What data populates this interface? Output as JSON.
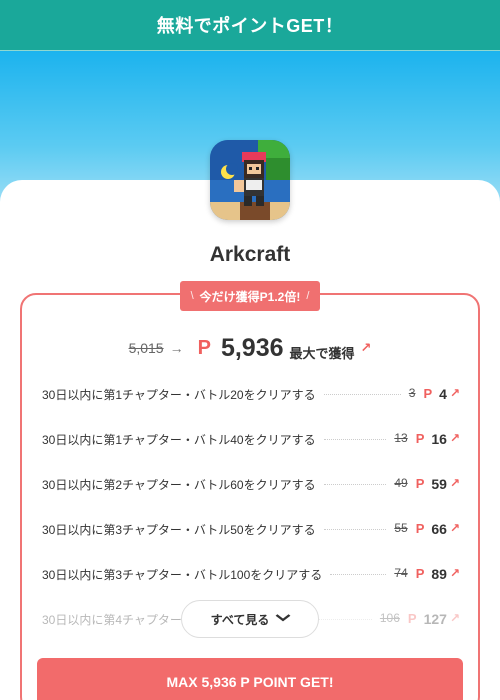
{
  "header": {
    "title": "無料でポイントGET！"
  },
  "app": {
    "name": "Arkcraft",
    "icon": "arkcraft-app-icon"
  },
  "badge": {
    "left": "\\",
    "text": "今だけ獲得P1.2倍!",
    "right": "/"
  },
  "total": {
    "old": "5,015",
    "arrow": "→",
    "p": "P",
    "value": "5,936",
    "label": "最大で獲得",
    "up": "↗"
  },
  "tasks": [
    {
      "label": "30日以内に第1チャプター・バトル20をクリアする",
      "old": "3",
      "p": "P",
      "points": "4",
      "up": "↗"
    },
    {
      "label": "30日以内に第1チャプター・バトル40をクリアする",
      "old": "13",
      "p": "P",
      "points": "16",
      "up": "↗"
    },
    {
      "label": "30日以内に第2チャプター・バトル60をクリアする",
      "old": "49",
      "p": "P",
      "points": "59",
      "up": "↗"
    },
    {
      "label": "30日以内に第3チャプター・バトル50をクリアする",
      "old": "55",
      "p": "P",
      "points": "66",
      "up": "↗"
    },
    {
      "label": "30日以内に第3チャプター・バトル100をクリアする",
      "old": "74",
      "p": "P",
      "points": "89",
      "up": "↗"
    },
    {
      "label": "30日以内に第4チャプター",
      "old": "106",
      "p": "P",
      "points": "127",
      "up": "↗"
    }
  ],
  "see_all": {
    "label": "すべて見る",
    "icon": "chevron-down-icon"
  },
  "cta": {
    "label": "MAX 5,936 P POINT GET!"
  },
  "colors": {
    "header": "#1aa89a",
    "accent": "#f07070",
    "sky": "#1cb3ee"
  }
}
